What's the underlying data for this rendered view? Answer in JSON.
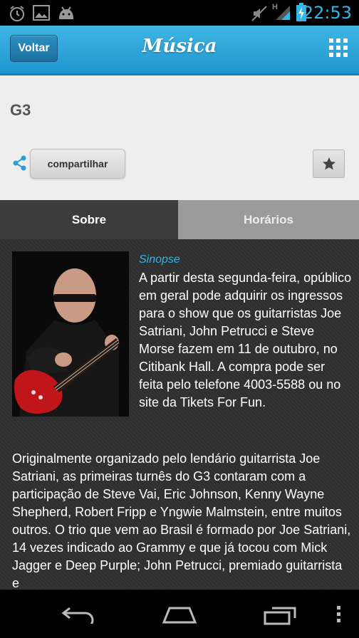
{
  "status_bar": {
    "time": "22:53",
    "network_label": "H",
    "colors": {
      "clock": "#33b5e5"
    },
    "icons": [
      "alarm-icon",
      "image-icon",
      "android-icon",
      "mute-icon",
      "signal-icon",
      "battery-charging-icon"
    ]
  },
  "action_bar": {
    "back_label": "Voltar",
    "title": "Música",
    "menu_icon": "grid-menu-icon",
    "colors": {
      "bar": "#2aa6db"
    }
  },
  "event": {
    "title": "G3",
    "share_label": "compartilhar",
    "favorite_icon": "star-icon"
  },
  "tabs": [
    {
      "label": "Sobre",
      "active": true
    },
    {
      "label": "Horários",
      "active": false
    }
  ],
  "content": {
    "sinopse_label": "Sinopse",
    "sinopse_text": "A partir desta segunda-feira, opúblico em geral pode adquirir os ingressos para o show que os guitarristas Joe Satriani, John Petrucci e Steve Morse fazem em 11 de outubro, no Citibank Hall. A compra pode ser feita pelo telefone 4003-5588 ou no site da Tikets For Fun.",
    "body_text": "Originalmente organizado pelo lendário guitarrista Joe Satriani, as primeiras turnês do G3 contaram com a participação de Steve Vai, Eric Johnson, Kenny Wayne Shepherd, Robert Fripp e Yngwie Malmstein, entre muitos outros. O trio que vem ao Brasil é formado por Joe Satriani, 14 vezes indicado ao Grammy e que já tocou com Mick Jagger e Deep Purple; John Petrucci, premiado guitarrista e"
  },
  "nav_bar": {
    "icons": [
      "back-nav-icon",
      "home-nav-icon",
      "recent-apps-icon",
      "overflow-menu-icon"
    ]
  }
}
